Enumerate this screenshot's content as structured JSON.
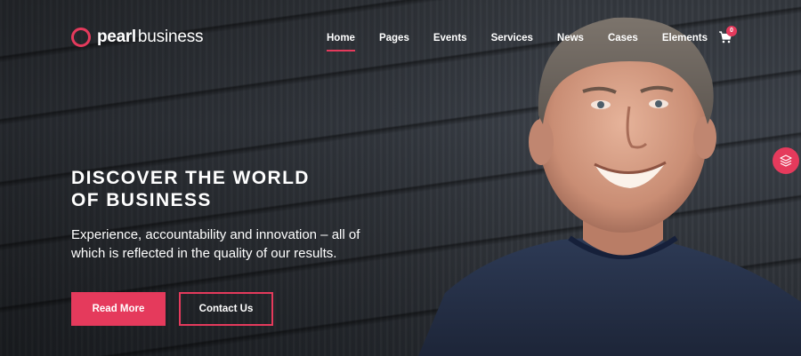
{
  "brand": {
    "bold": "pearl",
    "light": "business",
    "accent": "#e53a5c"
  },
  "nav": {
    "items": [
      {
        "label": "Home",
        "active": true
      },
      {
        "label": "Pages"
      },
      {
        "label": "Events"
      },
      {
        "label": "Services"
      },
      {
        "label": "News"
      },
      {
        "label": "Cases"
      },
      {
        "label": "Elements"
      }
    ],
    "cart_count": "0"
  },
  "hero": {
    "title_line1": "DISCOVER THE WORLD",
    "title_line2": "OF BUSINESS",
    "subtitle": "Experience, accountability and innovation – all of which is reflected in the quality of our results.",
    "primary_button": "Read More",
    "secondary_button": "Contact Us"
  },
  "icons": {
    "cart": "cart-icon",
    "layers": "layers-icon",
    "logo": "ring-logo-icon"
  }
}
